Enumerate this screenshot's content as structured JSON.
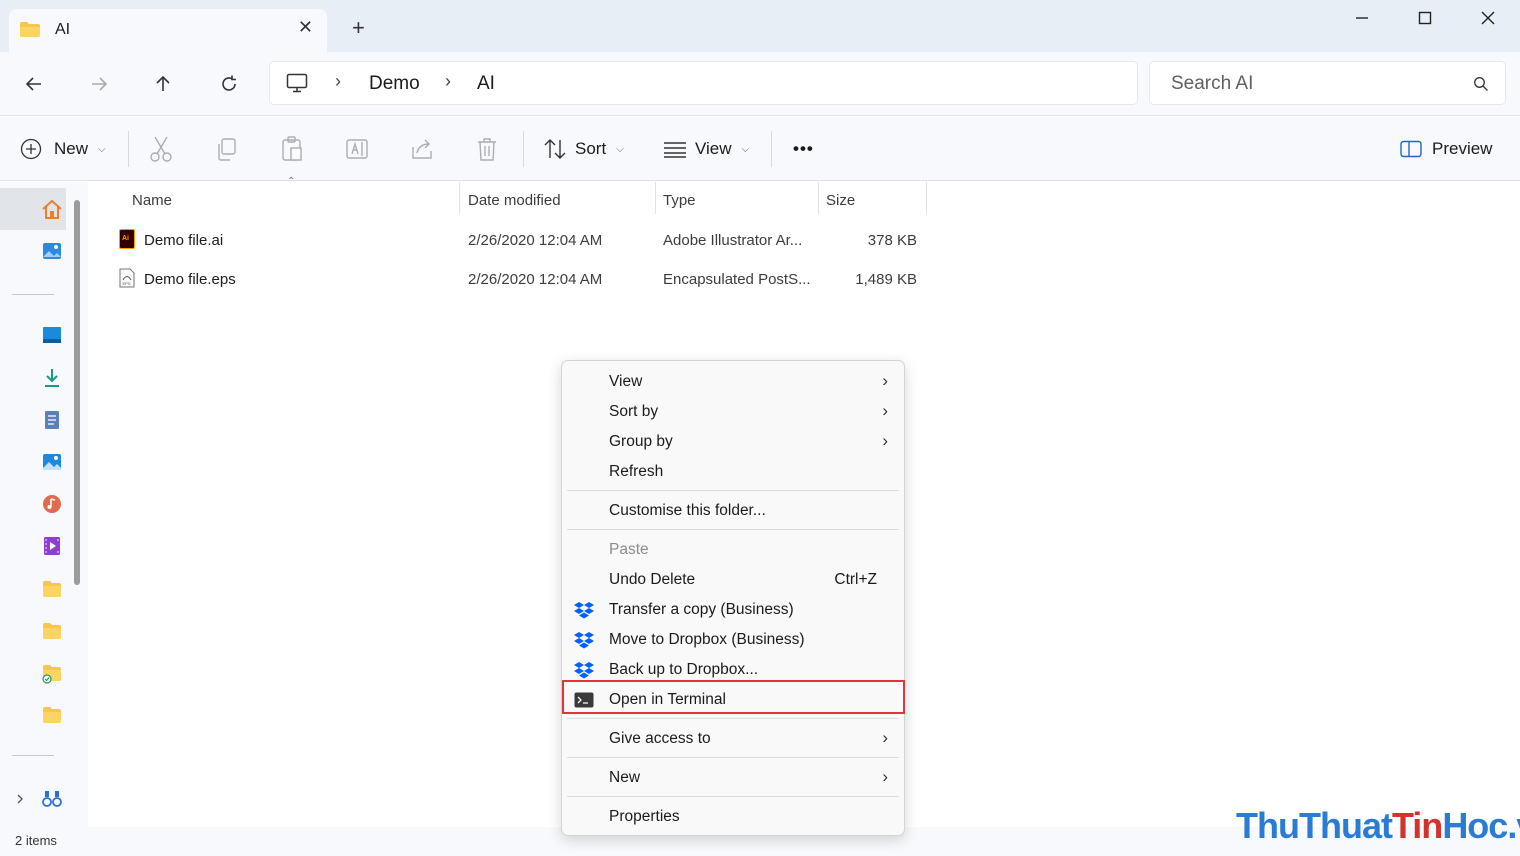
{
  "tab": {
    "title": "AI",
    "close": "✕",
    "new_tab": "+"
  },
  "breadcrumb": {
    "items": [
      "Demo",
      "AI"
    ],
    "sep": "›"
  },
  "search": {
    "placeholder": "Search AI"
  },
  "toolbar": {
    "new": "New",
    "sort": "Sort",
    "view": "View",
    "more": "•••",
    "preview": "Preview"
  },
  "columns": {
    "name": "Name",
    "date": "Date modified",
    "type": "Type",
    "size": "Size"
  },
  "files": [
    {
      "name": "Demo file.ai",
      "date": "2/26/2020 12:04 AM",
      "type": "Adobe Illustrator Ar...",
      "size": "378 KB"
    },
    {
      "name": "Demo file.eps",
      "date": "2/26/2020 12:04 AM",
      "type": "Encapsulated PostS...",
      "size": "1,489 KB"
    }
  ],
  "status": {
    "count": "2 items"
  },
  "context_menu": {
    "view": "View",
    "sort_by": "Sort by",
    "group_by": "Group by",
    "refresh": "Refresh",
    "customise": "Customise this folder...",
    "paste": "Paste",
    "undo_delete": "Undo Delete",
    "undo_shortcut": "Ctrl+Z",
    "transfer_copy": "Transfer a copy (Business)",
    "move_dropbox": "Move to Dropbox (Business)",
    "backup_dropbox": "Back up to Dropbox...",
    "open_terminal": "Open in Terminal",
    "give_access": "Give access to",
    "new": "New",
    "properties": "Properties",
    "submenu_arrow": "›"
  },
  "watermark": {
    "part1": "Thu",
    "part2": "Thuat",
    "part3": "Tin",
    "part4": "Hoc",
    "part5": ".vn"
  },
  "colors": {
    "highlight": "#e0353f",
    "dropbox": "#0061fe",
    "accent": "#0067c0"
  }
}
